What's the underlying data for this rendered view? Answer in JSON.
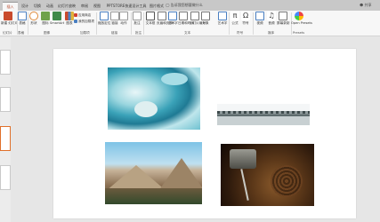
{
  "tabs": [
    {
      "label": "插入",
      "active": true
    },
    {
      "label": "设计"
    },
    {
      "label": "切换"
    },
    {
      "label": "动画"
    },
    {
      "label": "幻灯片放映"
    },
    {
      "label": "审阅"
    },
    {
      "label": "视图"
    },
    {
      "label": "PPTSTORE快速设计工具"
    },
    {
      "label": "图片格式"
    }
  ],
  "tell_me": "告诉我您想要做什么",
  "share": "共享",
  "ribbon": {
    "new_slide": "新建\n幻灯片",
    "table": "表格",
    "images": "图片",
    "online_images": "联机图片",
    "screenshot": "屏幕截图",
    "album": "相册",
    "shapes": "形状",
    "icons": "图标",
    "smartart": "SmartArt",
    "chart": "图表",
    "store": "应用商店",
    "my_addins": "我的加载项",
    "zoom": "缩放定位",
    "link": "链接",
    "action": "动作",
    "comment": "批注",
    "textbox": "文本框",
    "header_footer": "页眉和页脚",
    "wordart": "艺术字",
    "date_time": "日期和时间",
    "slide_number": "幻灯片编号",
    "object": "对象",
    "equation": "公式",
    "symbol": "符号",
    "video": "视频",
    "audio": "音频",
    "screen_recording": "屏幕录制",
    "open_presets": "Open Presets"
  },
  "groups": {
    "slides": "幻灯片",
    "tables": "表格",
    "images": "图像",
    "illustrations": "插图",
    "addins": "加载项",
    "links": "链接",
    "comments": "批注",
    "text": "文本",
    "symbols": "符号",
    "media": "媒体",
    "presets": "Presets"
  },
  "colors": {
    "accent": "#b7472a",
    "thumb_selected": "#e0702a"
  }
}
